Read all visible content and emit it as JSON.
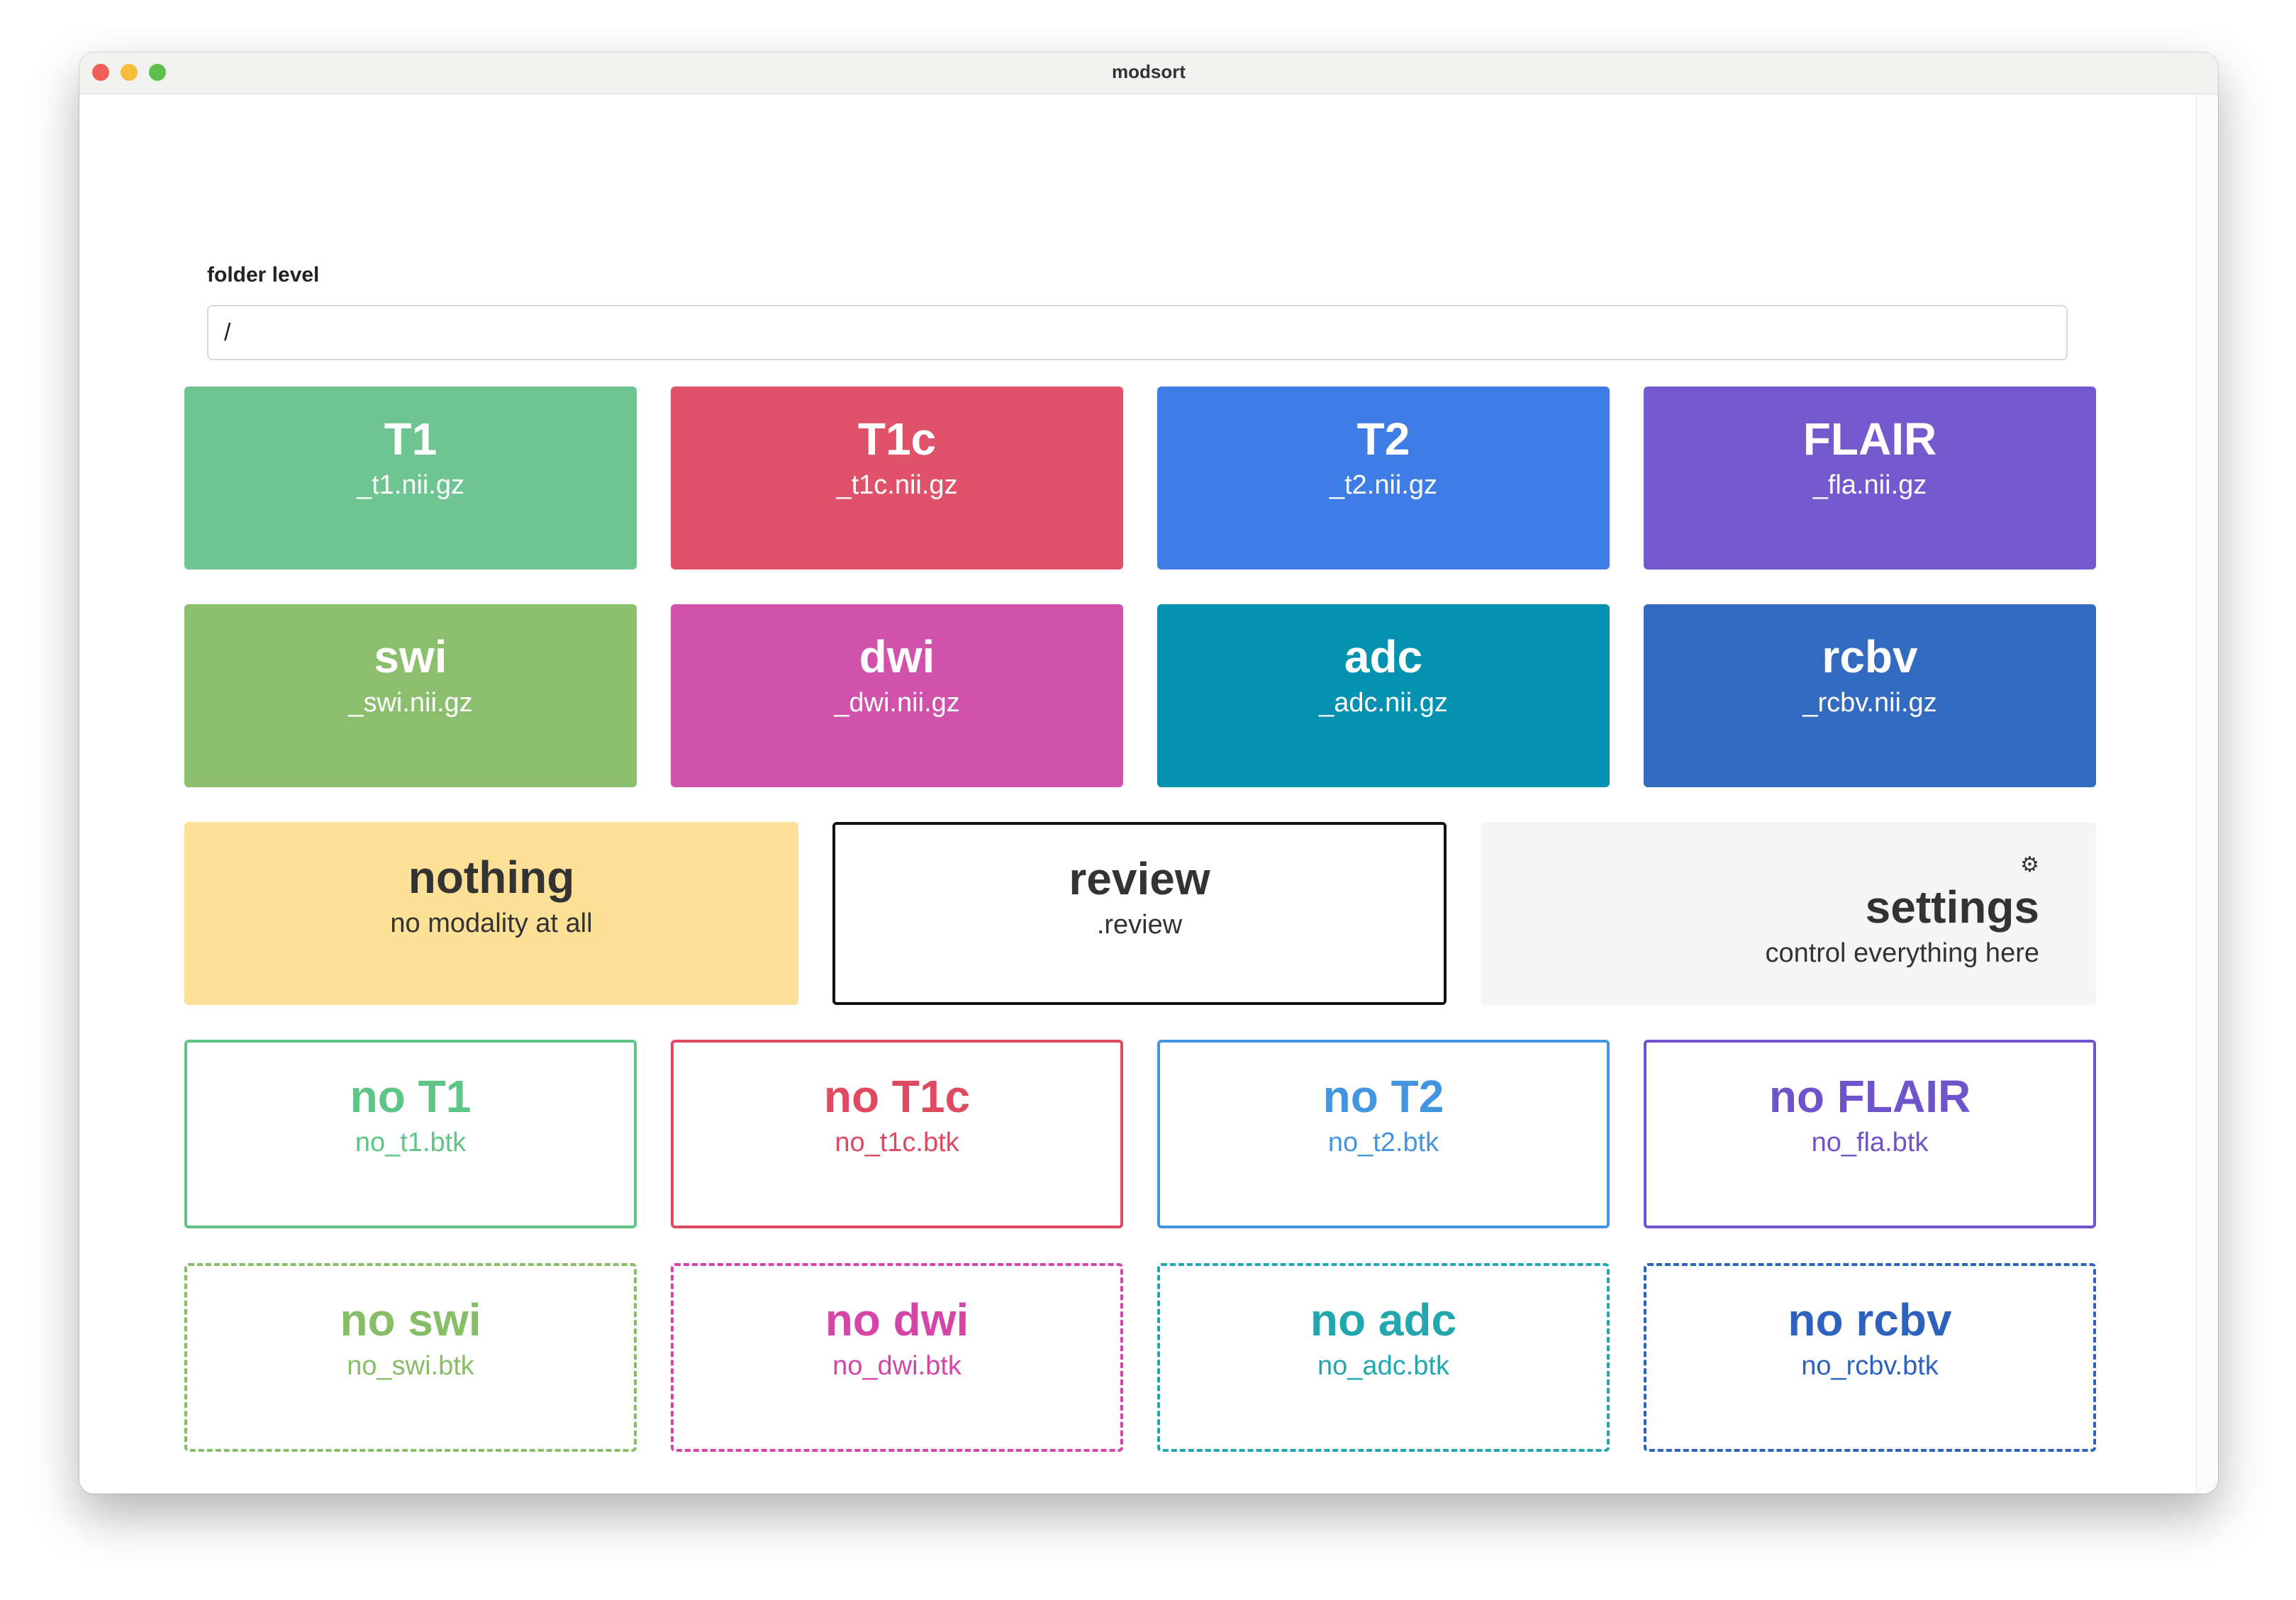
{
  "window": {
    "title": "modsort"
  },
  "folder": {
    "label": "folder level",
    "value": "/"
  },
  "modalities": [
    {
      "title": "T1",
      "sub": "_t1.nii.gz",
      "color": "#6fc591"
    },
    {
      "title": "T1c",
      "sub": "_t1c.nii.gz",
      "color": "#e0526a"
    },
    {
      "title": "T2",
      "sub": "_t2.nii.gz",
      "color": "#3e7de6"
    },
    {
      "title": "FLAIR",
      "sub": "_fla.nii.gz",
      "color": "#7459ce"
    },
    {
      "title": "swi",
      "sub": "_swi.nii.gz",
      "color": "#8bbf6e"
    },
    {
      "title": "dwi",
      "sub": "_dwi.nii.gz",
      "color": "#d052ab"
    },
    {
      "title": "adc",
      "sub": "_adc.nii.gz",
      "color": "#0492b2"
    },
    {
      "title": "rcbv",
      "sub": "_rcbv.nii.gz",
      "color": "#336bc1"
    }
  ],
  "specials": {
    "nothing": {
      "title": "nothing",
      "sub": "no modality at all",
      "color": "#fbe095"
    },
    "review": {
      "title": "review",
      "sub": ".review"
    },
    "settings": {
      "title": "settings",
      "sub": "control everything here",
      "icon": "gear-icon",
      "glyph": "⚙"
    }
  },
  "exclusions": [
    {
      "title": "no T1",
      "sub": "no_t1.btk",
      "color": "#5fc586"
    },
    {
      "title": "no T1c",
      "sub": "no_t1c.btk",
      "color": "#e04a60"
    },
    {
      "title": "no T2",
      "sub": "no_t2.btk",
      "color": "#4495e0"
    },
    {
      "title": "no FLAIR",
      "sub": "no_fla.btk",
      "color": "#6e53cb"
    },
    {
      "title": "no swi",
      "sub": "no_swi.btk",
      "color": "#86bd66"
    },
    {
      "title": "no dwi",
      "sub": "no_dwi.btk",
      "color": "#d545a8"
    },
    {
      "title": "no adc",
      "sub": "no_adc.btk",
      "color": "#22a7ae"
    },
    {
      "title": "no rcbv",
      "sub": "no_rcbv.btk",
      "color": "#2e62bf"
    }
  ]
}
